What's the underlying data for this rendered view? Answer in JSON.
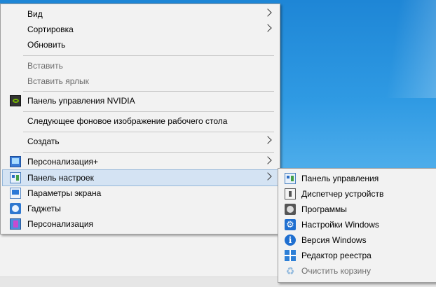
{
  "colors": {
    "menu_bg": "#f2f2f2",
    "highlight": "#d4e3f3",
    "desktop": "#2f9ae3"
  },
  "main_menu": {
    "items": [
      {
        "label": "Вид"
      },
      {
        "label": "Сортировка"
      },
      {
        "label": "Обновить"
      },
      {
        "label": "Вставить"
      },
      {
        "label": "Вставить ярлык"
      },
      {
        "label": "Панель управления NVIDIA"
      },
      {
        "label": "Следующее фоновое изображение рабочего стола"
      },
      {
        "label": "Создать"
      },
      {
        "label": "Персонализация+"
      },
      {
        "label": "Панель настроек"
      },
      {
        "label": "Параметры экрана"
      },
      {
        "label": "Гаджеты"
      },
      {
        "label": "Персонализация"
      }
    ]
  },
  "submenu": {
    "items": [
      {
        "label": "Панель управления"
      },
      {
        "label": "Диспетчер устройств"
      },
      {
        "label": "Программы"
      },
      {
        "label": "Настройки Windows"
      },
      {
        "label": "Версия Windows"
      },
      {
        "label": "Редактор реестра"
      },
      {
        "label": "Очистить корзину"
      }
    ]
  },
  "icons": {
    "gear": "⚙",
    "info": "i",
    "recycle": "♻"
  }
}
